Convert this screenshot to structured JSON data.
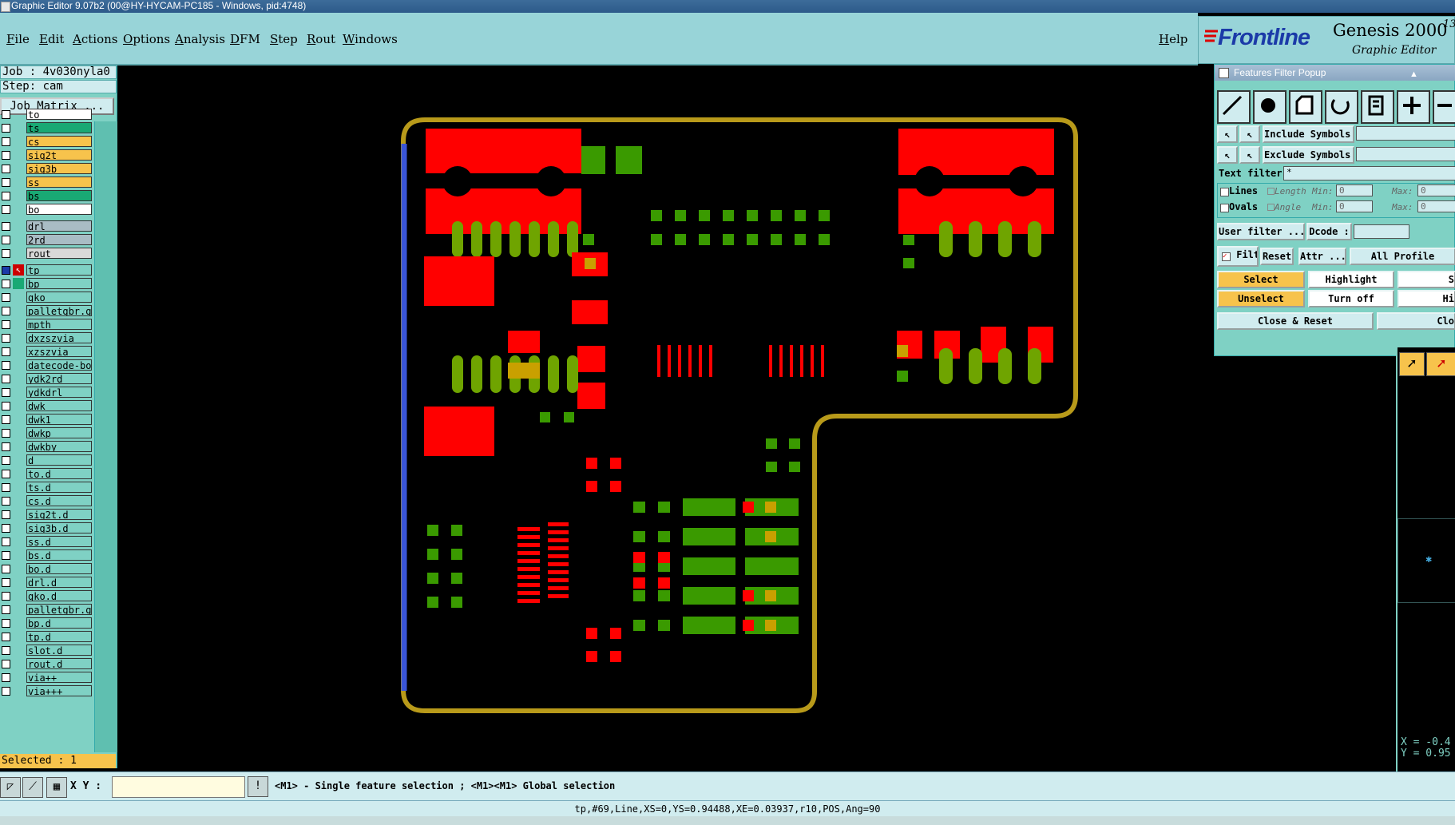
{
  "window": {
    "title": "Graphic Editor 9.07b2 (00@HY-HYCAM-PC185 - Windows, pid:4748)"
  },
  "menu": {
    "items": [
      "File",
      "Edit",
      "Actions",
      "Options",
      "Analysis",
      "DFM",
      "Step",
      "Rout",
      "Windows"
    ],
    "help": "Help"
  },
  "logo": {
    "brand": "Frontline",
    "product": "Genesis 2000",
    "superscript": "13",
    "subtitle": "Graphic Editor"
  },
  "job": {
    "job_line": "Job : 4v030nyla0",
    "step_line": "Step: cam",
    "matrix_button": "Job Matrix ..."
  },
  "layers": [
    {
      "name": "to",
      "color": "#ffffff"
    },
    {
      "name": "ts",
      "color": "#19a974"
    },
    {
      "name": "cs",
      "color": "#f7c34c"
    },
    {
      "name": "sig2t",
      "color": "#f7c34c"
    },
    {
      "name": "sig3b",
      "color": "#f7c34c"
    },
    {
      "name": "ss",
      "color": "#f7c34c"
    },
    {
      "name": "bs",
      "color": "#19a974"
    },
    {
      "name": "bo",
      "color": "#ffffff"
    },
    {
      "name": "drl",
      "color": "#a9bcc4"
    },
    {
      "name": "2rd",
      "color": "#a9bcc4"
    },
    {
      "name": "rout",
      "color": "#d9d9d9"
    },
    {
      "name": "tp",
      "color": "#7fd1c4",
      "state": "work"
    },
    {
      "name": "bp",
      "color": "#7fd1c4",
      "state": "affected"
    },
    {
      "name": "gko",
      "color": "#7fd1c4"
    },
    {
      "name": "palletgbr.gk",
      "color": "#7fd1c4"
    },
    {
      "name": "mpth",
      "color": "#7fd1c4"
    },
    {
      "name": "dxzszvia",
      "color": "#7fd1c4"
    },
    {
      "name": "xzszvia",
      "color": "#7fd1c4"
    },
    {
      "name": "datecode-bo",
      "color": "#7fd1c4"
    },
    {
      "name": "ydk2rd",
      "color": "#7fd1c4"
    },
    {
      "name": "ydkdrl",
      "color": "#7fd1c4"
    },
    {
      "name": "dwk",
      "color": "#7fd1c4"
    },
    {
      "name": "dwk1",
      "color": "#7fd1c4"
    },
    {
      "name": "dwkp",
      "color": "#7fd1c4"
    },
    {
      "name": "dwkby",
      "color": "#7fd1c4"
    },
    {
      "name": "d",
      "color": "#7fd1c4"
    },
    {
      "name": "to.d",
      "color": "#7fd1c4"
    },
    {
      "name": "ts.d",
      "color": "#7fd1c4"
    },
    {
      "name": "cs.d",
      "color": "#7fd1c4"
    },
    {
      "name": "sig2t.d",
      "color": "#7fd1c4"
    },
    {
      "name": "sig3b.d",
      "color": "#7fd1c4"
    },
    {
      "name": "ss.d",
      "color": "#7fd1c4"
    },
    {
      "name": "bs.d",
      "color": "#7fd1c4"
    },
    {
      "name": "bo.d",
      "color": "#7fd1c4"
    },
    {
      "name": "drl.d",
      "color": "#7fd1c4"
    },
    {
      "name": "gko.d",
      "color": "#7fd1c4"
    },
    {
      "name": "palletgbr.gk",
      "color": "#7fd1c4"
    },
    {
      "name": "bp.d",
      "color": "#7fd1c4"
    },
    {
      "name": "tp.d",
      "color": "#7fd1c4"
    },
    {
      "name": "slot.d",
      "color": "#7fd1c4"
    },
    {
      "name": "rout.d",
      "color": "#7fd1c4"
    },
    {
      "name": "via++",
      "color": "#7fd1c4"
    },
    {
      "name": "via+++",
      "color": "#7fd1c4"
    }
  ],
  "status": {
    "selected": "Selected : 1",
    "xy_label": "X Y :",
    "hint": "<M1> - Single feature selection ; <M1><M1> Global selection",
    "feature_info": "tp,#69,Line,XS=0,YS=0.94488,XE=0.03937,r10,POS,Ang=90",
    "coord_x": "X = -0.4",
    "coord_y": "Y = 0.95"
  },
  "popup": {
    "title": "Features Filter Popup",
    "include_symbols": "Include Symbols :",
    "exclude_symbols": "Exclude Symbols :",
    "text_filter": "Text filter",
    "text_filter_value": "*",
    "lines": "Lines",
    "ovals": "Ovals",
    "length": "Length",
    "angle": "Angle",
    "min": "Min:",
    "max": "Max:",
    "min_value": "0",
    "max_value": "0",
    "user_filter": "User filter ...",
    "dcode": "Dcode :",
    "filter": "Filter",
    "reset": "Reset",
    "attr": "Attr ...",
    "all_profile": "All Profile",
    "select": "Select",
    "highlight": "Highlight",
    "unselect": "Unselect",
    "turn_off": "Turn off",
    "close_reset": "Close & Reset",
    "close": "Clo",
    "col3_a": "S",
    "col3_b": "Hi"
  },
  "colors": {
    "profile": "#b89a1a",
    "pad_top": "#ff0000",
    "pad_bottom": "#3a9a00",
    "overlap": "#c9a000",
    "work_line": "#3a55d6",
    "panel": "#7fd1c4",
    "menubar": "#98d4d8"
  }
}
